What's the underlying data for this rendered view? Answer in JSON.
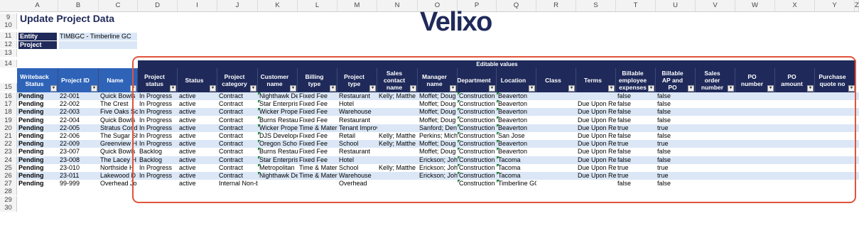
{
  "columns": [
    "A",
    "B",
    "C",
    "D",
    "I",
    "J",
    "K",
    "L",
    "M",
    "N",
    "O",
    "P",
    "Q",
    "R",
    "S",
    "T",
    "U",
    "V",
    "W",
    "X",
    "Y",
    "Z"
  ],
  "row_numbers": [
    "9",
    "10",
    "11",
    "12",
    "13",
    "14",
    "15",
    "16",
    "17",
    "18",
    "19",
    "20",
    "21",
    "22",
    "23",
    "24",
    "25",
    "26",
    "27",
    "28",
    "29",
    "30"
  ],
  "title": "Update Project Data",
  "logo": "Velixo",
  "entity": {
    "label": "Entity",
    "value": "TIMBGC - Timberline GC"
  },
  "project": {
    "label": "Project",
    "value": ""
  },
  "editable_label": "Editable values",
  "headers": {
    "writeback": "Writeback Status",
    "project_id": "Project ID",
    "name": "Name",
    "project_status": "Project status",
    "status": "Status",
    "project_category": "Project category",
    "customer_name": "Customer name",
    "billing_type": "Billing type",
    "project_type": "Project type",
    "sales_contact": "Sales contact name",
    "manager_name": "Manager name",
    "department": "Department",
    "location": "Location",
    "class": "Class",
    "terms": "Terms",
    "billable_employee": "Billable employee expenses",
    "billable_ap": "Billable AP and PO",
    "sales_order": "Sales order number",
    "po_number": "PO number",
    "po_amount": "PO amount",
    "purchase_quote": "Purchase quote no"
  },
  "rows": [
    {
      "wb": "Pending",
      "id": "22-001",
      "name": "Quick Bowls",
      "pstatus": "In Progress",
      "status": "active",
      "cat": "Contract",
      "cust": "Nighthawk De",
      "bill": "Fixed Fee",
      "ptype": "Restaurant",
      "sales": "Kelly; Matthe",
      "mgr": "Moffet; Doug",
      "dept": "Construction",
      "loc": "Beaverton",
      "terms": "",
      "bemp": "false",
      "bap": "false"
    },
    {
      "wb": "Pending",
      "id": "22-002",
      "name": "The Crest",
      "pstatus": "In Progress",
      "status": "active",
      "cat": "Contract",
      "cust": "Star Enterpris",
      "bill": "Fixed Fee",
      "ptype": "Hotel",
      "sales": "",
      "mgr": "Moffet; Doug",
      "dept": "Construction",
      "loc": "Beaverton",
      "terms": "Due Upon Re",
      "bemp": "false",
      "bap": "false"
    },
    {
      "wb": "Pending",
      "id": "22-003",
      "name": "Five Oaks Sc",
      "pstatus": "In Progress",
      "status": "active",
      "cat": "Contract",
      "cust": "Wicker Prope",
      "bill": "Fixed Fee",
      "ptype": "Warehouse",
      "sales": "",
      "mgr": "Moffet; Doug",
      "dept": "Construction",
      "loc": "Beaverton",
      "terms": "Due Upon Re",
      "bemp": "false",
      "bap": "false"
    },
    {
      "wb": "Pending",
      "id": "22-004",
      "name": "Quick Bowls",
      "pstatus": "In Progress",
      "status": "active",
      "cat": "Contract",
      "cust": "Burns Restau",
      "bill": "Fixed Fee",
      "ptype": "Restaurant",
      "sales": "",
      "mgr": "Moffet; Doug",
      "dept": "Construction",
      "loc": "Beaverton",
      "terms": "Due Upon Re",
      "bemp": "false",
      "bap": "false"
    },
    {
      "wb": "Pending",
      "id": "22-005",
      "name": "Stratus Cond",
      "pstatus": "In Progress",
      "status": "active",
      "cat": "Contract",
      "cust": "Wicker Prope",
      "bill": "Time & Mater",
      "ptype": "Tenant Improvement",
      "sales": "",
      "mgr": "Sanford; Den",
      "dept": "Construction",
      "loc": "Beaverton",
      "terms": "Due Upon Re",
      "bemp": "true",
      "bap": "true"
    },
    {
      "wb": "Pending",
      "id": "22-006",
      "name": "The Sugar Sh",
      "pstatus": "In Progress",
      "status": "active",
      "cat": "Contract",
      "cust": "DJS Develope",
      "bill": "Fixed Fee",
      "ptype": "Retail",
      "sales": "Kelly; Matthe",
      "mgr": "Perkins; Mich",
      "dept": "Construction",
      "loc": "San Jose",
      "terms": "Due Upon Re",
      "bemp": "false",
      "bap": "false"
    },
    {
      "wb": "Pending",
      "id": "22-009",
      "name": "Greenview H",
      "pstatus": "In Progress",
      "status": "active",
      "cat": "Contract",
      "cust": "Oregon Scho",
      "bill": "Fixed Fee",
      "ptype": "School",
      "sales": "Kelly; Matthe",
      "mgr": "Moffet; Doug",
      "dept": "Construction",
      "loc": "Beaverton",
      "terms": "Due Upon Re",
      "bemp": "true",
      "bap": "true"
    },
    {
      "wb": "Pending",
      "id": "23-007",
      "name": "Quick Bowls",
      "pstatus": "Backlog",
      "status": "active",
      "cat": "Contract",
      "cust": "Burns Restau",
      "bill": "Fixed Fee",
      "ptype": "Restaurant",
      "sales": "",
      "mgr": "Moffet; Doug",
      "dept": "Construction",
      "loc": "Beaverton",
      "terms": "Due Upon Re",
      "bemp": "false",
      "bap": "false"
    },
    {
      "wb": "Pending",
      "id": "23-008",
      "name": "The Lacey H",
      "pstatus": "Backlog",
      "status": "active",
      "cat": "Contract",
      "cust": "Star Enterpris",
      "bill": "Fixed Fee",
      "ptype": "Hotel",
      "sales": "",
      "mgr": "Erickson; Joh",
      "dept": "Construction",
      "loc": "Tacoma",
      "terms": "Due Upon Re",
      "bemp": "false",
      "bap": "false"
    },
    {
      "wb": "Pending",
      "id": "23-010",
      "name": "Northside H",
      "pstatus": "In Progress",
      "status": "active",
      "cat": "Contract",
      "cust": "Metropolitan",
      "bill": "Time & Mater",
      "ptype": "School",
      "sales": "Kelly; Matthe",
      "mgr": "Erickson; Joh",
      "dept": "Construction",
      "loc": "Tacoma",
      "terms": "Due Upon Re",
      "bemp": "true",
      "bap": "true"
    },
    {
      "wb": "Pending",
      "id": "23-011",
      "name": "Lakewood D",
      "pstatus": "In Progress",
      "status": "active",
      "cat": "Contract",
      "cust": "Nighthawk De",
      "bill": "Time & Mater",
      "ptype": "Warehouse",
      "sales": "",
      "mgr": "Erickson; Joh",
      "dept": "Construction",
      "loc": "Tacoma",
      "terms": "Due Upon Re",
      "bemp": "true",
      "bap": "true"
    },
    {
      "wb": "Pending",
      "id": "99-999",
      "name": "Overhead Jo",
      "pstatus": "",
      "status": "active",
      "cat": "Internal Non-billable",
      "cust": "",
      "bill": "",
      "ptype": "Overhead",
      "sales": "",
      "mgr": "",
      "dept": "Construction",
      "loc": "Timberline GC",
      "terms": "",
      "bemp": "false",
      "bap": "false"
    }
  ]
}
